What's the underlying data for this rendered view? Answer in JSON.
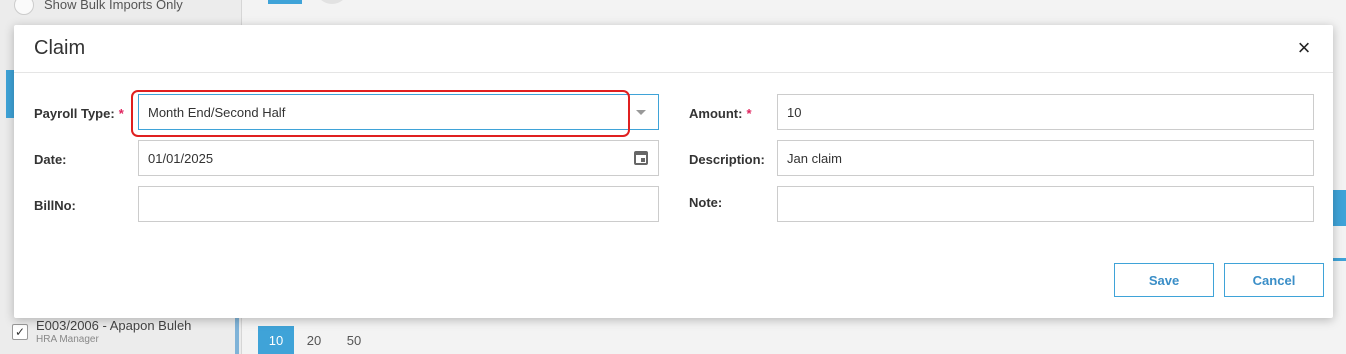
{
  "background": {
    "bulk_imports_label": "Show Bulk Imports Only",
    "employee": {
      "name": "E003/2006 - Apapon Buleh",
      "role": "HRA Manager",
      "check": "✓"
    },
    "pager": [
      "10",
      "20",
      "50"
    ]
  },
  "modal": {
    "title": "Claim",
    "close_glyph": "×",
    "required_mark": "*",
    "fields": {
      "payroll_type": {
        "label": "Payroll Type:",
        "value": "Month End/Second Half"
      },
      "date": {
        "label": "Date:",
        "value": "01/01/2025"
      },
      "bill_no": {
        "label": "BillNo:",
        "value": ""
      },
      "amount": {
        "label": "Amount:",
        "value": "10"
      },
      "description": {
        "label": "Description:",
        "value": "Jan claim"
      },
      "note": {
        "label": "Note:",
        "value": ""
      }
    },
    "buttons": {
      "save": "Save",
      "cancel": "Cancel"
    }
  },
  "colors": {
    "accent": "#3fa3d8",
    "required": "#e0245e",
    "highlight": "#e02020"
  }
}
